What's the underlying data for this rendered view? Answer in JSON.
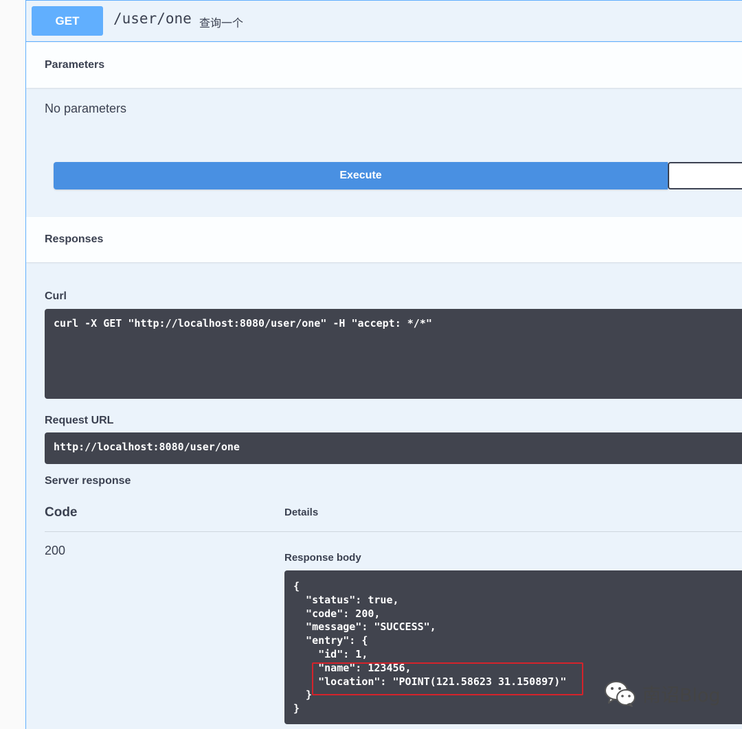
{
  "operation": {
    "method": "GET",
    "path": "/user/one",
    "summary": "查询一个",
    "method_color": "#61affe"
  },
  "parameters": {
    "title": "Parameters",
    "empty_text": "No parameters"
  },
  "execute": {
    "label": "Execute",
    "clear_label": ""
  },
  "responses": {
    "title": "Responses",
    "curl_label": "Curl",
    "curl_command": "curl -X GET \"http://localhost:8080/user/one\" -H \"accept: */*\"",
    "request_url_label": "Request URL",
    "request_url": "http://localhost:8080/user/one",
    "server_response_label": "Server response",
    "table": {
      "code_header": "Code",
      "details_header": "Details"
    },
    "code": "200",
    "response_body_label": "Response body",
    "response_body_lines": [
      "{",
      "  \"status\": true,",
      "  \"code\": 200,",
      "  \"message\": \"SUCCESS\",",
      "  \"entry\": {",
      "    \"id\": 1,",
      "    \"name\": 123456,",
      "    \"location\": \"POINT(121.58623 31.150897)\"",
      "  }",
      "}"
    ]
  },
  "watermark": {
    "icon": "wechat-icon",
    "text": "南诏Blog"
  }
}
